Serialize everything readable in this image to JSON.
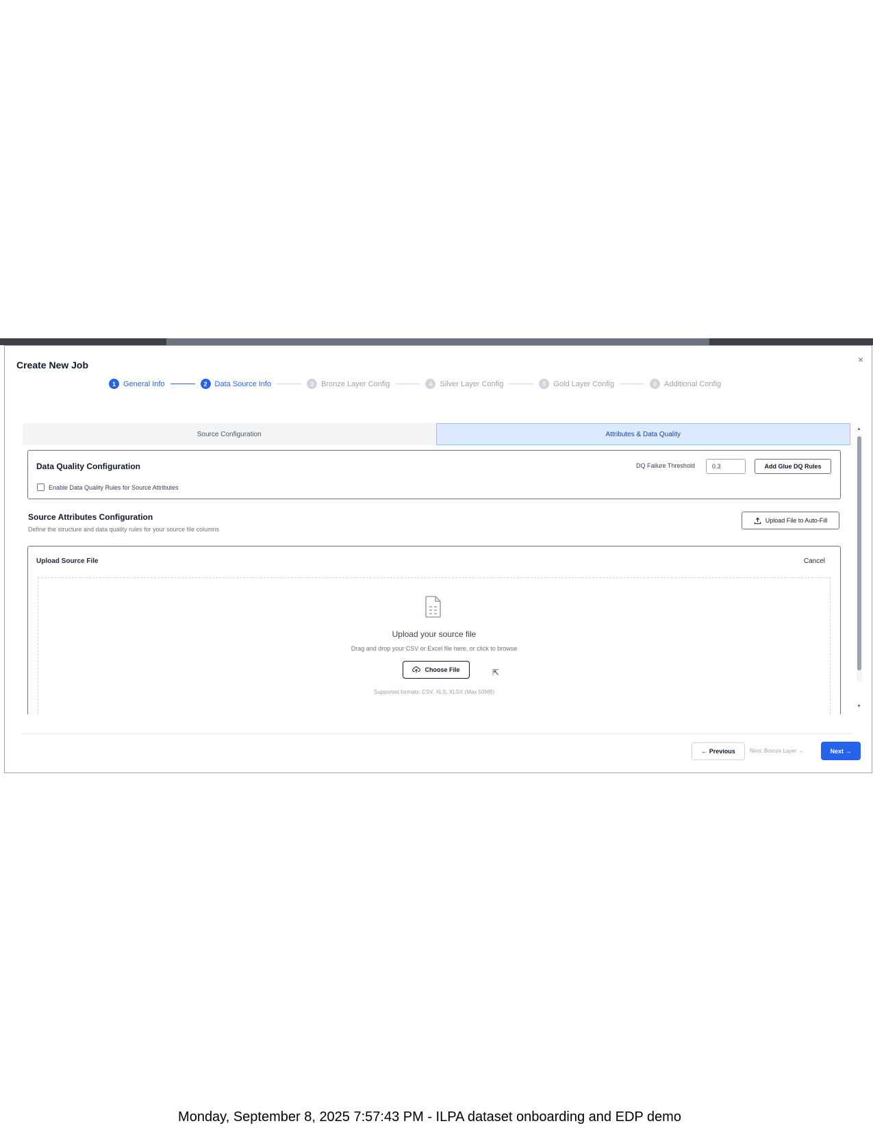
{
  "modal": {
    "title": "Create New Job",
    "close_glyph": "×"
  },
  "stepper": [
    {
      "num": "1",
      "label": "General Info",
      "state": "active"
    },
    {
      "num": "2",
      "label": "Data Source Info",
      "state": "active"
    },
    {
      "num": "3",
      "label": "Bronze Layer Config",
      "state": "inactive"
    },
    {
      "num": "4",
      "label": "Silver Layer Config",
      "state": "inactive"
    },
    {
      "num": "5",
      "label": "Gold Layer Config",
      "state": "inactive"
    },
    {
      "num": "6",
      "label": "Additional Config",
      "state": "inactive"
    }
  ],
  "tabs": {
    "source": "Source Configuration",
    "attributes": "Attributes & Data Quality",
    "selected": "attributes"
  },
  "dq": {
    "title": "Data Quality Configuration",
    "threshold_label": "DQ Failure Threshold",
    "threshold_value": "0.3",
    "add_button": "Add Glue DQ Rules",
    "enable_label": "Enable Data Quality Rules for Source Attributes",
    "enabled": false
  },
  "attributes": {
    "title": "Source Attributes Configuration",
    "subtitle": "Define the structure and data quality rules for your source file columns",
    "upload_button": "Upload File to Auto-Fill"
  },
  "upload": {
    "title": "Upload Source File",
    "cancel": "Cancel",
    "heading": "Upload your source file",
    "sub": "Drag and drop your CSV or Excel file here, or click to browse",
    "choose_button": "Choose File",
    "formats": "Supported formats: CSV, XLS, XLSX (Max 50MB)"
  },
  "footer": {
    "previous": "← Previous",
    "next_hint": "Next: Bronze Layer →",
    "next": "Next →"
  },
  "caption": "Monday, September 8, 2025 7:57:43 PM - ILPA dataset onboarding and EDP demo",
  "colors": {
    "accent": "#2563eb",
    "tab_selected_bg": "#dbeafe"
  }
}
